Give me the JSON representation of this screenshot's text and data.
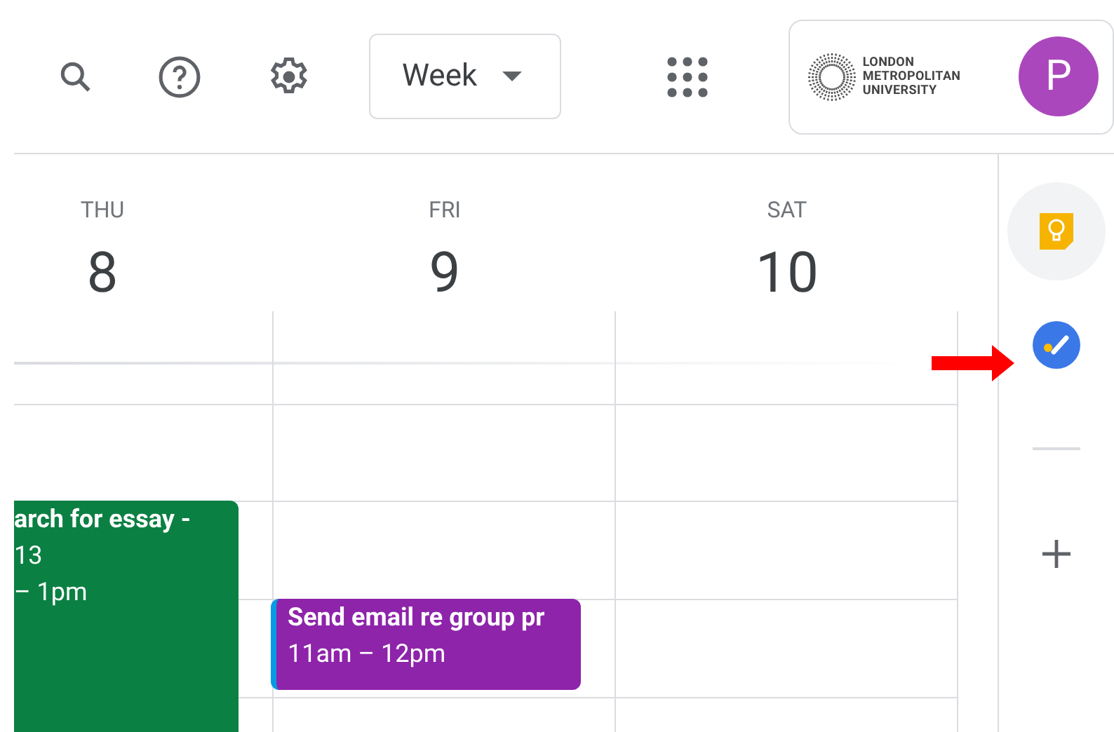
{
  "toolbar": {
    "view_selector": "Week",
    "account": {
      "org_name": [
        "LONDON",
        "METROPOLITAN",
        "UNIVERSITY"
      ],
      "avatar_letter": "P"
    }
  },
  "days": [
    {
      "weekday": "THU",
      "date": "8"
    },
    {
      "weekday": "FRI",
      "date": "9"
    },
    {
      "weekday": "SAT",
      "date": "10"
    }
  ],
  "events": [
    {
      "lines": [
        "arch for essay -",
        "13",
        "– 1pm"
      ],
      "color": "#0b8043"
    },
    {
      "lines": [
        "Send email re group pr",
        "11am – 12pm"
      ],
      "color": "#8e24aa"
    }
  ]
}
